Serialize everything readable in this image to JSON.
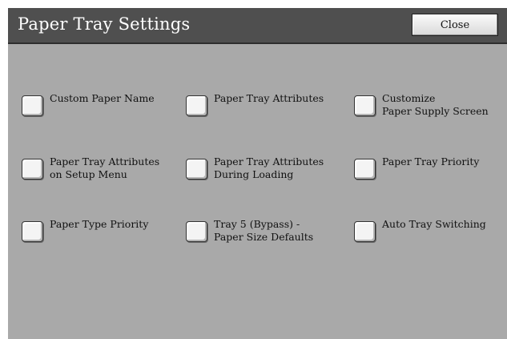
{
  "header": {
    "title": "Paper Tray Settings",
    "close_label": "Close"
  },
  "options": [
    {
      "label": "Custom Paper Name",
      "checked": false
    },
    {
      "label": "Paper Tray Attributes",
      "checked": false
    },
    {
      "label": "Customize\nPaper Supply Screen",
      "checked": false
    },
    {
      "label": "Paper Tray Attributes\non Setup Menu",
      "checked": false
    },
    {
      "label": "Paper Tray Attributes\nDuring Loading",
      "checked": false
    },
    {
      "label": "Paper Tray Priority",
      "checked": false
    },
    {
      "label": "Paper Type Priority",
      "checked": false
    },
    {
      "label": "Tray 5 (Bypass) -\nPaper Size Defaults",
      "checked": false
    },
    {
      "label": "Auto Tray Switching",
      "checked": false
    }
  ]
}
